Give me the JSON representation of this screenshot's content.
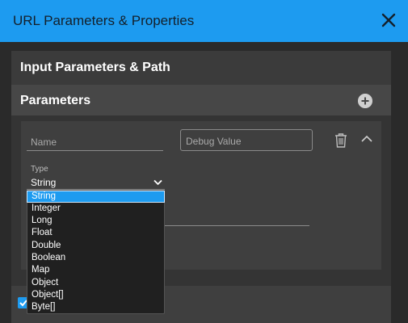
{
  "window": {
    "title": "URL Parameters & Properties"
  },
  "sections": {
    "input_title": "Input Parameters & Path",
    "parameters_title": "Parameters"
  },
  "parameter": {
    "name_placeholder": "Name",
    "debug_placeholder": "Debug Value",
    "type_label": "Type",
    "type_value": "String"
  },
  "type_options": [
    "String",
    "Integer",
    "Long",
    "Float",
    "Double",
    "Boolean",
    "Map",
    "Object",
    "Object[]",
    "Byte[]"
  ],
  "selected_option": "String",
  "colors": {
    "accent": "#1d9bf0",
    "background": "#2b2b2b"
  },
  "icons": {
    "close": "close-icon",
    "add": "add-circle-icon",
    "delete": "trash-icon",
    "collapse": "chevron-up-icon",
    "dropdown": "chevron-down-icon",
    "checkbox": "checkbox-checked-icon"
  }
}
